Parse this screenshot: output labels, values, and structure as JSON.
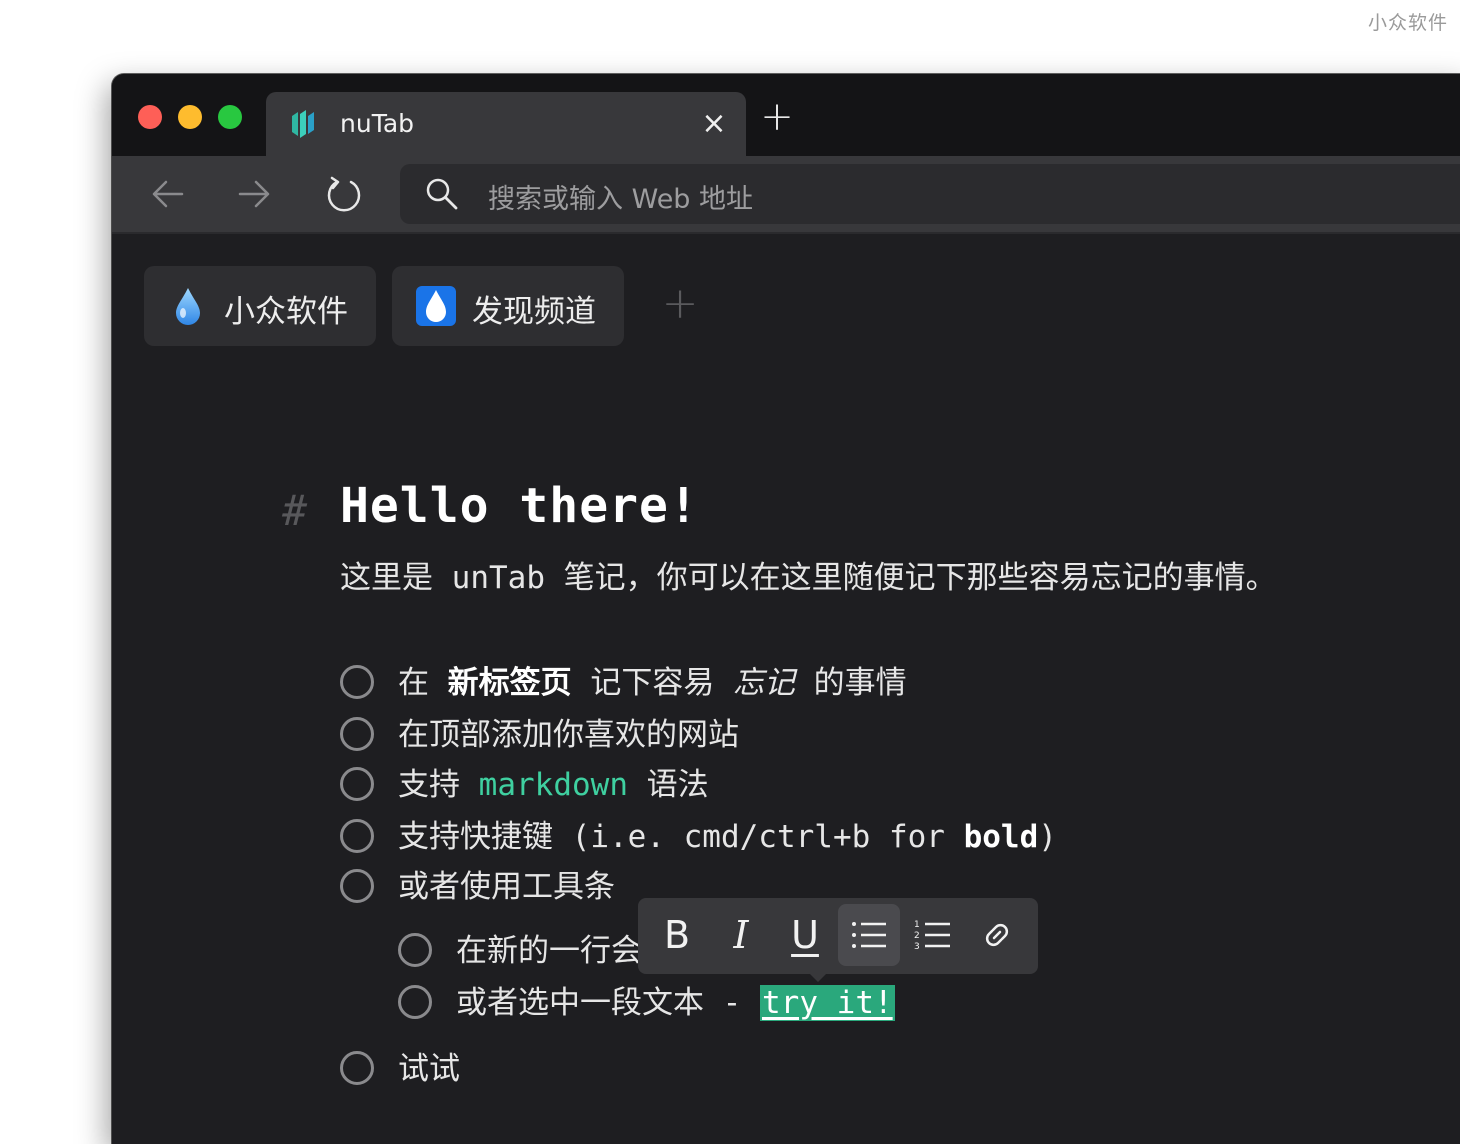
{
  "watermark": "小众软件",
  "tab": {
    "title": "nuTab",
    "close_glyph": "×",
    "new_tab_glyph": "+"
  },
  "address_bar": {
    "placeholder": "搜索或输入 Web 地址"
  },
  "bookmarks": [
    {
      "label": "小众软件",
      "icon": "droplet-icon"
    },
    {
      "label": "发现频道",
      "icon": "droplet-square-icon"
    }
  ],
  "bookmark_add_glyph": "+",
  "note": {
    "hash": "#",
    "heading": "Hello there!",
    "subtitle": "这里是 unTab 笔记，你可以在这里随便记下那些容易忘记的事情。",
    "items": [
      {
        "pre": "在 ",
        "bold": "新标签页",
        "mid": " 记下容易 ",
        "italic": "忘记",
        "post": " 的事情"
      },
      {
        "text": "在顶部添加你喜欢的网站"
      },
      {
        "pre": "支持 ",
        "code": "markdown",
        "post": " 语法"
      },
      {
        "pre": "支持快捷键 (i.e. cmd/ctrl+b for ",
        "bold": "bold",
        "post": ")"
      },
      {
        "text": "或者使用工具条"
      },
      {
        "text": "在新的一行会"
      },
      {
        "pre": "或者选中一段文本 - ",
        "highlight": "try it!"
      },
      {
        "text": "试试"
      }
    ]
  },
  "format_toolbar": {
    "bold": "B",
    "italic": "I",
    "underline": "U",
    "bullet_list": "bullet-list-icon",
    "numbered_list": "numbered-list-icon",
    "link": "link-icon"
  },
  "colors": {
    "accent": "#3fd0a0",
    "highlight": "#2aa87c",
    "background": "#1e1e21",
    "tabbar": "#141416"
  }
}
